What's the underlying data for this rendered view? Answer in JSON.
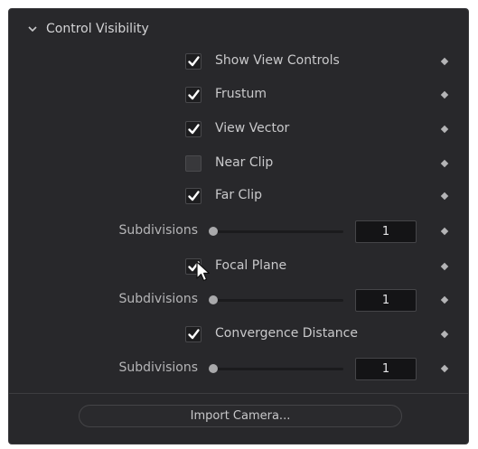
{
  "section": {
    "title": "Control Visibility"
  },
  "checkboxes": [
    {
      "label": "Show View Controls",
      "checked": true
    },
    {
      "label": "Frustum",
      "checked": true
    },
    {
      "label": "View Vector",
      "checked": true
    },
    {
      "label": "Near Clip",
      "checked": false
    },
    {
      "label": "Far Clip",
      "checked": true
    },
    {
      "label": "Focal Plane",
      "checked": true
    },
    {
      "label": "Convergence Distance",
      "checked": true
    }
  ],
  "sliders": [
    {
      "label": "Subdivisions",
      "value": "1",
      "fraction": 0.0
    },
    {
      "label": "Subdivisions",
      "value": "1",
      "fraction": 0.0
    },
    {
      "label": "Subdivisions",
      "value": "1",
      "fraction": 0.0
    }
  ],
  "import_button": {
    "label": "Import Camera..."
  },
  "icons": {
    "collapse": "chevron-down-icon",
    "keyframe": "diamond-icon",
    "check": "checkmark-icon",
    "cursor": "mouse-pointer-icon"
  },
  "colors": {
    "panel_bg": "#28282b",
    "text": "#c9c9cb",
    "field_bg": "#141416"
  }
}
